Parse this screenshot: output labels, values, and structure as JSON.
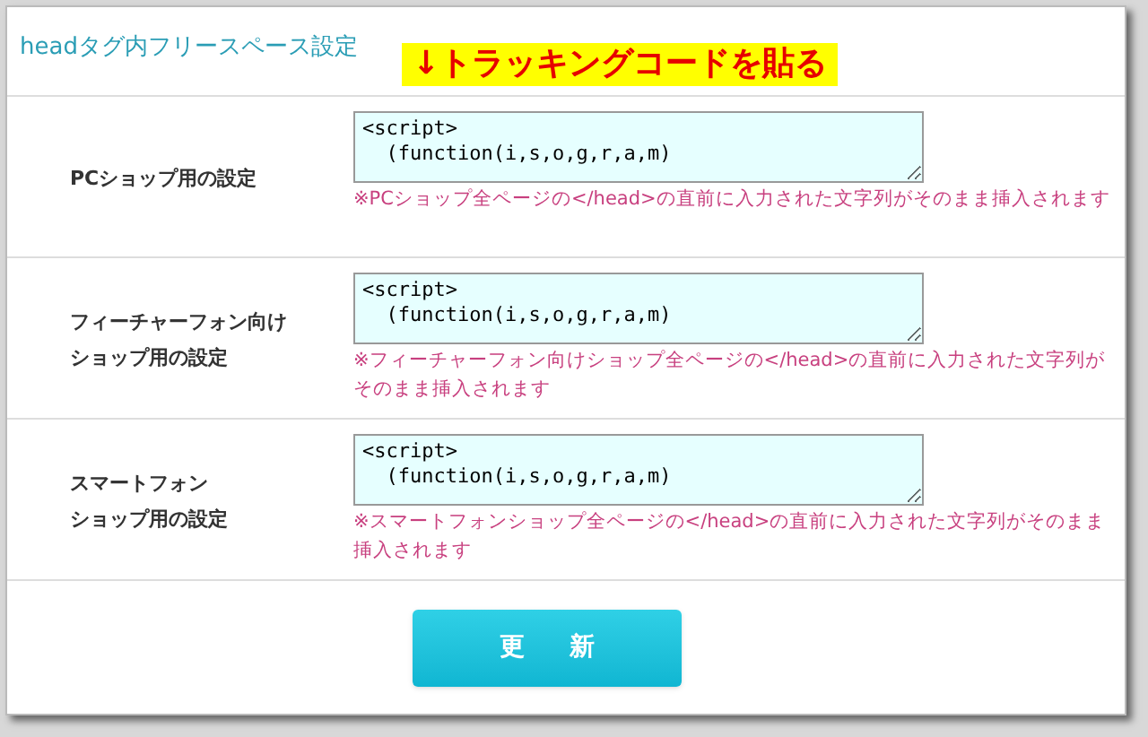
{
  "section_title": "headタグ内フリースペース設定",
  "annotation": "↓トラッキングコードを貼る",
  "rows": [
    {
      "label": [
        "PCショップ用の設定"
      ],
      "code": "<script>\n  (function(i,s,o,g,r,a,m)",
      "note": "※PCショップ全ページの</head>の直前に入力された文字列がそのまま挿入されます"
    },
    {
      "label": [
        "フィーチャーフォン向け",
        "ショップ用の設定"
      ],
      "code": "<script>\n  (function(i,s,o,g,r,a,m)",
      "note": "※フィーチャーフォン向けショップ全ページの</head>の直前に入力された文字列がそのまま挿入されます"
    },
    {
      "label": [
        "スマートフォン",
        "ショップ用の設定"
      ],
      "code": "<script>\n  (function(i,s,o,g,r,a,m)",
      "note": "※スマートフォンショップ全ページの</head>の直前に入力された文字列がそのまま挿入されます"
    }
  ],
  "button": "更 新"
}
